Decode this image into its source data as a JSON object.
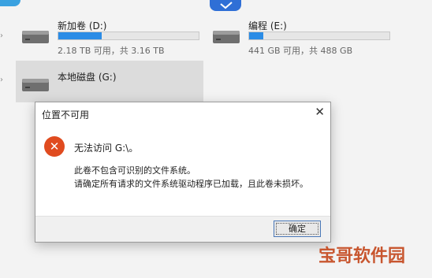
{
  "drives": [
    {
      "name": "新加卷 (D:)",
      "space": "2.18 TB 可用，共 3.16 TB",
      "used_fraction": 0.31
    },
    {
      "name": "编程 (E:)",
      "space": "441 GB 可用，共 488 GB",
      "used_fraction": 0.1
    },
    {
      "name": "本地磁盘 (G:)",
      "space": "",
      "used_fraction": 0
    }
  ],
  "dialog": {
    "title": "位置不可用",
    "close_glyph": "✕",
    "error_glyph": "✕",
    "message_main": "无法访问 G:\\。",
    "message_line1": "此卷不包含可识别的文件系统。",
    "message_line2": "请确定所有请求的文件系统驱动程序已加载，且此卷未损坏。",
    "ok_label": "确定"
  },
  "watermark": "宝哥软件园",
  "colors": {
    "accent": "#2b8ce6",
    "error": "#e04b1f",
    "watermark": "#c8562f"
  }
}
